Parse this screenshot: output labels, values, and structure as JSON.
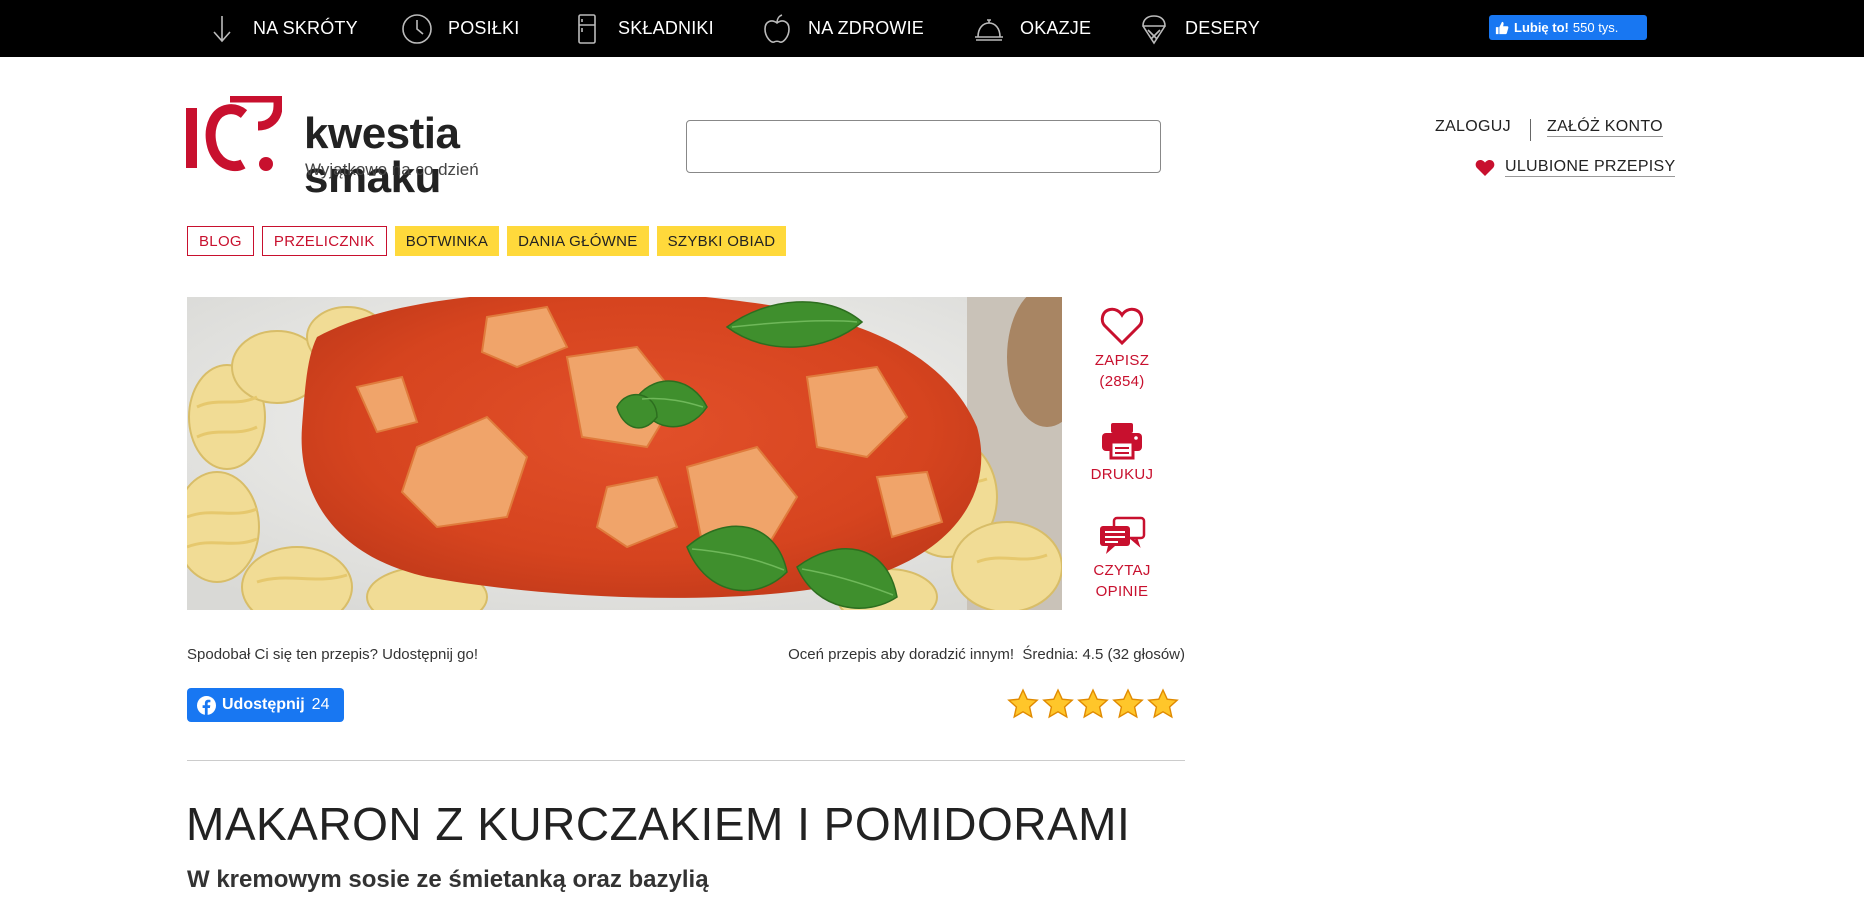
{
  "colors": {
    "brand_red": "#c8102e",
    "tag_yellow": "#ffd93b",
    "facebook_blue": "#1877f2",
    "topbar_bg": "#000000"
  },
  "topnav": {
    "items": [
      {
        "label": "NA SKRÓTY",
        "icon": "arrow-down-icon"
      },
      {
        "label": "POSIŁKI",
        "icon": "clock-icon"
      },
      {
        "label": "SKŁADNIKI",
        "icon": "fridge-icon"
      },
      {
        "label": "NA ZDROWIE",
        "icon": "apple-icon"
      },
      {
        "label": "OKAZJE",
        "icon": "cloche-icon"
      },
      {
        "label": "DESERY",
        "icon": "ice-cream-icon"
      }
    ],
    "fb_like": {
      "label": "Lubię to!",
      "count": "550 tys."
    }
  },
  "header": {
    "logo_title": "kwestia smaku",
    "logo_subtitle": "Wyjątkowo na co dzień",
    "search_value": "",
    "login_label": "ZALOGUJ",
    "register_label": "ZAŁÓŻ KONTO",
    "favorites_label": "ULUBIONE PRZEPISY"
  },
  "tags": [
    {
      "label": "BLOG",
      "style": "outline"
    },
    {
      "label": "PRZELICZNIK",
      "style": "outline"
    },
    {
      "label": "BOTWINKA",
      "style": "yellow"
    },
    {
      "label": "DANIA GŁÓWNE",
      "style": "yellow"
    },
    {
      "label": "SZYBKI OBIAD",
      "style": "yellow"
    }
  ],
  "actions": {
    "save_label": "ZAPISZ",
    "save_count": "(2854)",
    "print_label": "DRUKUJ",
    "reviews_line1": "CZYTAJ",
    "reviews_line2": "OPINIE"
  },
  "share": {
    "prompt": "Spodobał Ci się ten przepis? Udostępnij go!",
    "button_label": "Udostępnij",
    "button_count": "24"
  },
  "rating": {
    "prompt": "Oceń przepis aby doradzić innym!",
    "average_text": "Średnia: 4.5 (32 głosów)",
    "stars": 5
  },
  "recipe": {
    "title": "MAKARON Z KURCZAKIEM I POMIDORAMI",
    "subtitle": "W kremowym sosie ze śmietanką oraz bazylią"
  }
}
